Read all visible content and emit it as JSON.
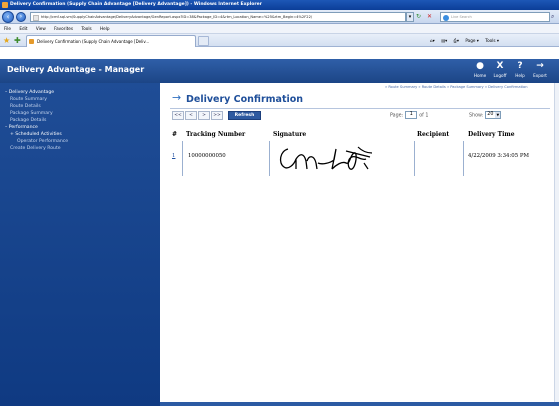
{
  "window": {
    "title": "Delivery Confirmation (Supply Chain Advantage [Delivery Advantage]) - Windows Internet Explorer"
  },
  "browser": {
    "url": "http://cmf-sql-vm/SupplyChainAdvantage/DeliveryAdvantage/GenReport.aspx?ID=38&Package_ID=4&rtm_Location_Name=%25&rtm_Begin=4%2F22/",
    "search_placeholder": "Live Search",
    "menu": [
      "File",
      "Edit",
      "View",
      "Favorites",
      "Tools",
      "Help"
    ],
    "tab_label": "Delivery Confirmation (Supply Chain Advantage [Deliv...",
    "toolbar": [
      "Page ▾",
      "Tools ▾"
    ]
  },
  "app": {
    "title": "Delivery Advantage - Manager",
    "header_actions": [
      {
        "glyph": "●",
        "label": "Home"
      },
      {
        "glyph": "X",
        "label": "Logoff"
      },
      {
        "glyph": "?",
        "label": "Help"
      },
      {
        "glyph": "→",
        "label": "Export"
      }
    ]
  },
  "sidebar": {
    "items": [
      {
        "label": "– Delivery Advantage",
        "level": "head"
      },
      {
        "label": "Route Summary",
        "level": "sub"
      },
      {
        "label": "Route Details",
        "level": "sub"
      },
      {
        "label": "Package Summary",
        "level": "sub"
      },
      {
        "label": "Package Details",
        "level": "sub"
      },
      {
        "label": "– Performance",
        "level": "head"
      },
      {
        "label": "+ Scheduled Activities",
        "level": "head"
      },
      {
        "label": "Operator Performance",
        "level": "sub"
      },
      {
        "label": "Create Delivery Route",
        "level": "sub"
      }
    ]
  },
  "main": {
    "breadcrumb": "» Route Summary » Route Details » Package Summary » Delivery Confirmation",
    "page_title": "Delivery Confirmation",
    "pager_buttons": [
      "<<",
      "<",
      ">",
      ">>"
    ],
    "refresh_label": "Refresh",
    "page_label": "Page:",
    "page_value": "1",
    "page_of": "of 1",
    "show_label": "Show:",
    "show_value": "20",
    "table": {
      "headers": [
        "#",
        "Tracking Number",
        "Signature",
        "Recipient",
        "Delivery Time"
      ],
      "rows": [
        {
          "num": "1",
          "tracking": "10000000050",
          "recipient": "",
          "delivery_time": "4/22/2009 3:34:05 PM"
        }
      ]
    }
  },
  "colors": {
    "app_header": "#1c4586",
    "sidebar": "#0f3a82",
    "title": "#1f4f9a"
  }
}
